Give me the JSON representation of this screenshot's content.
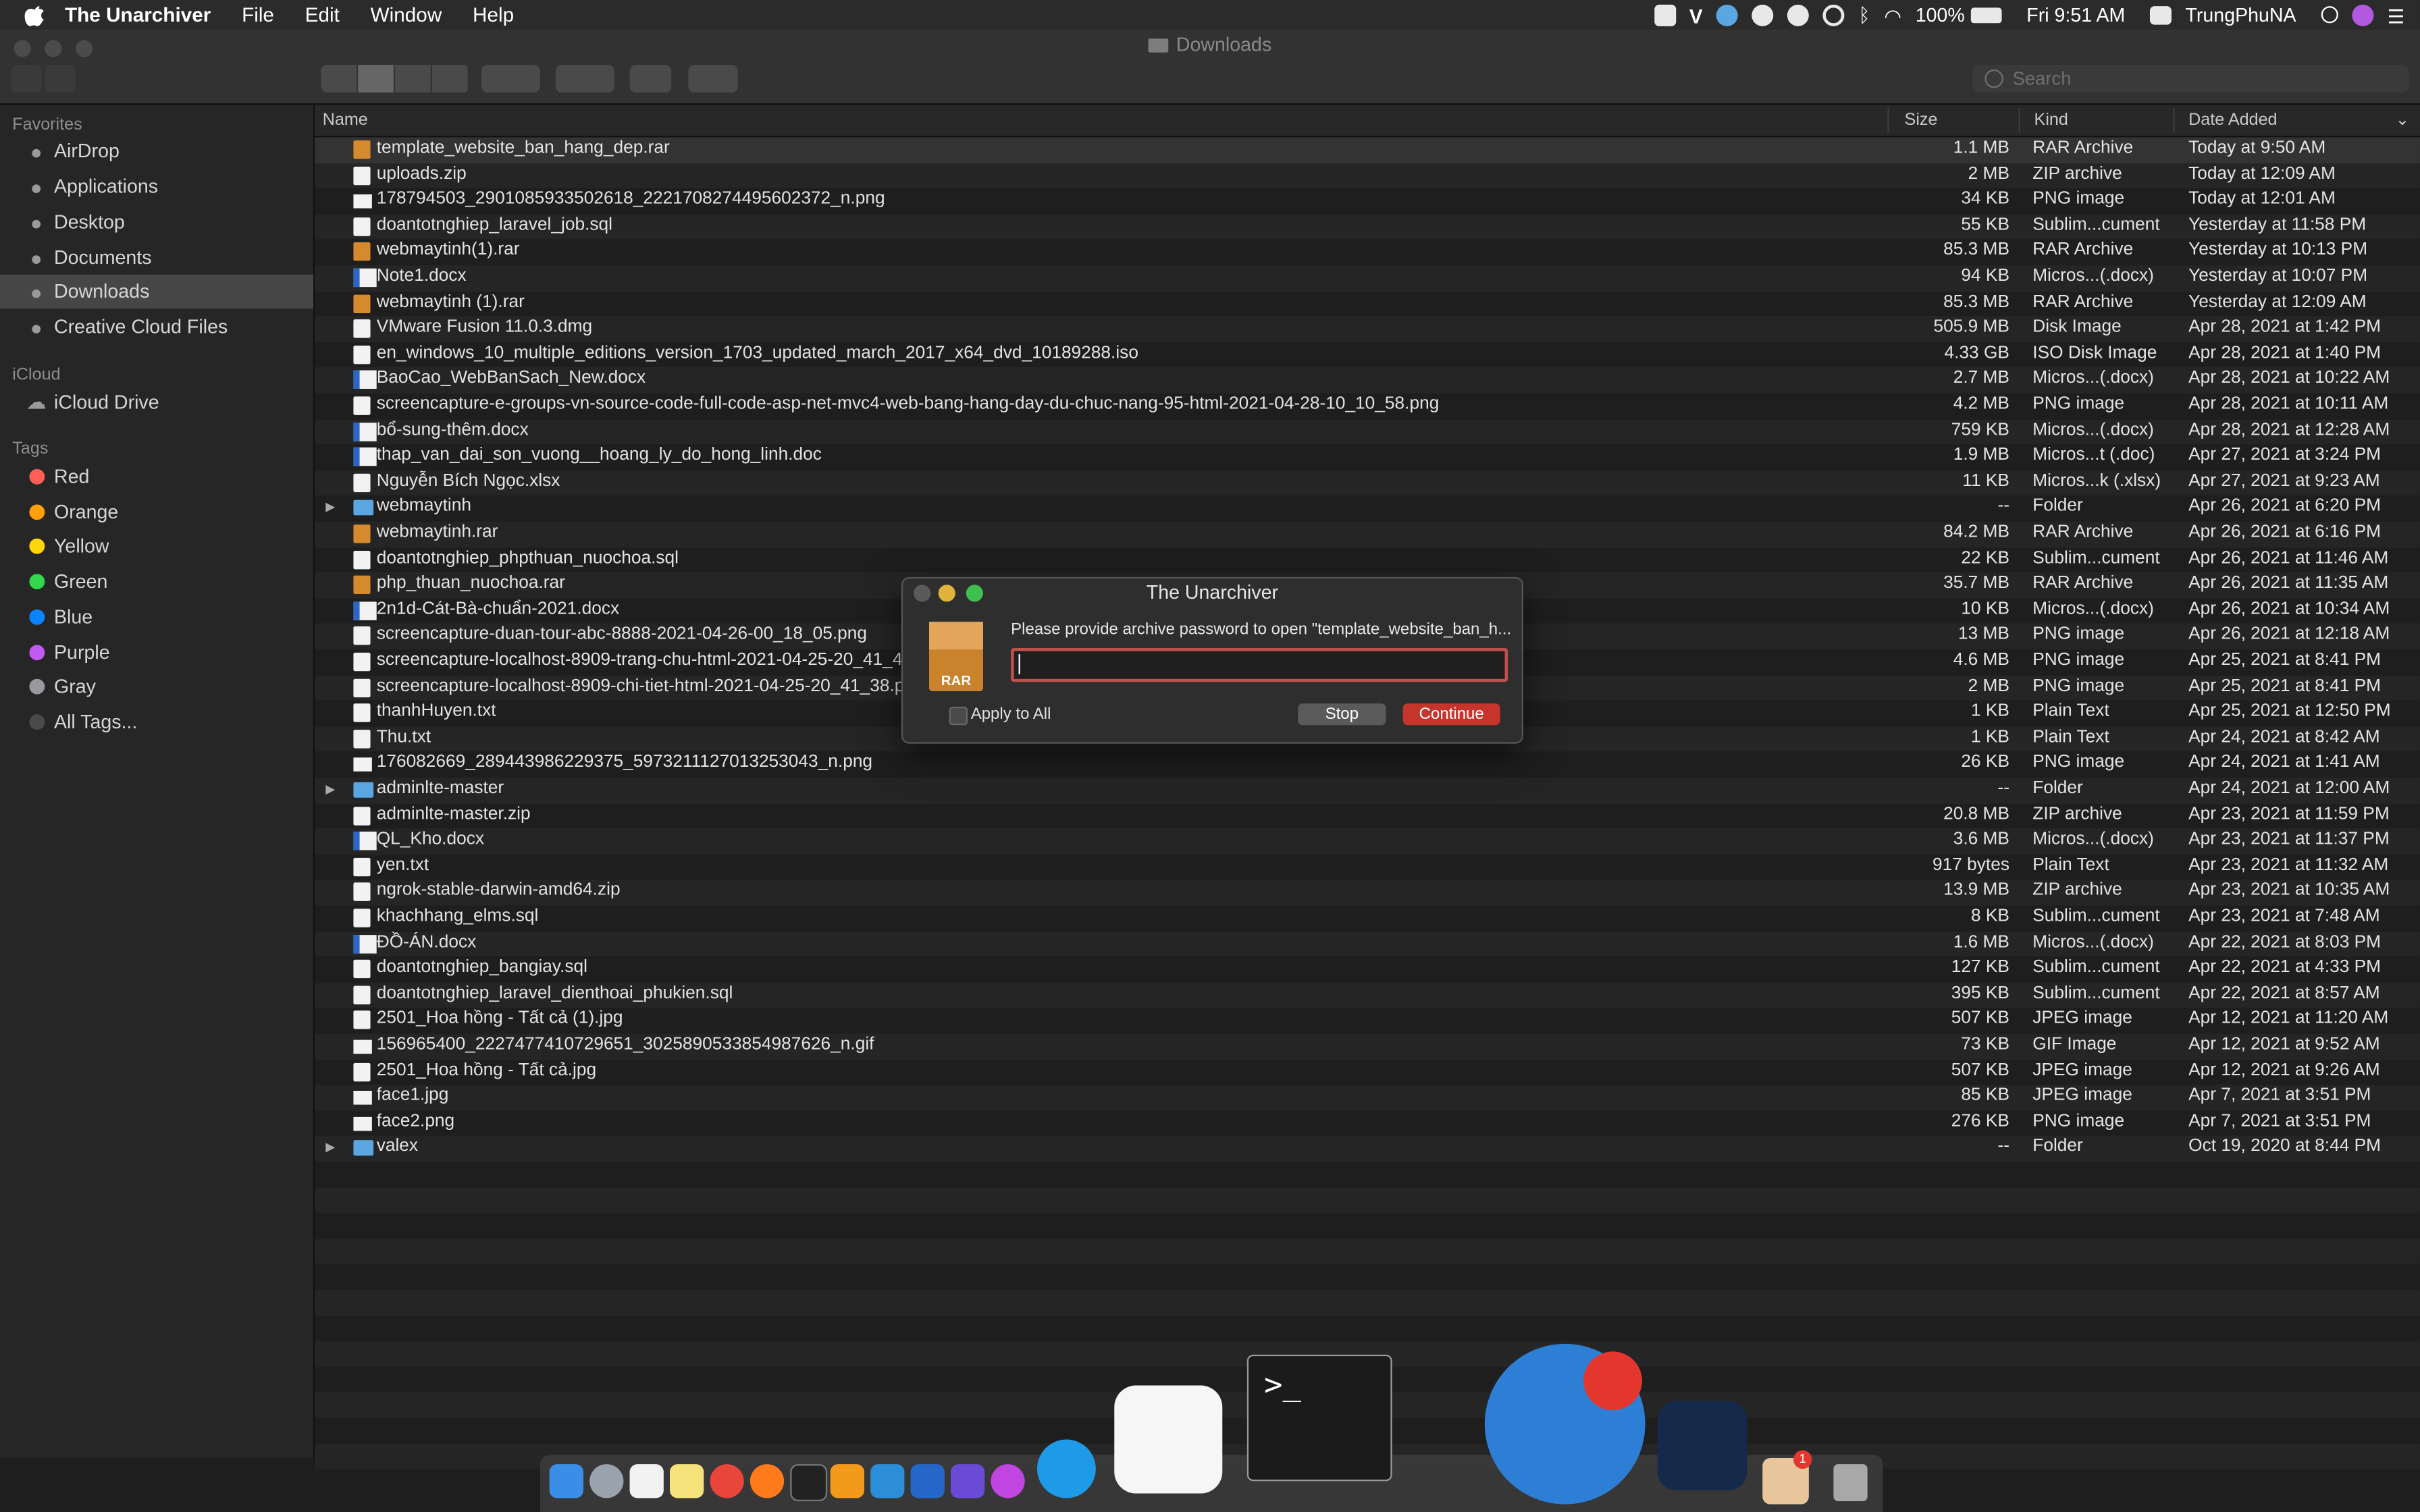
{
  "menubar": {
    "app_name": "The Unarchiver",
    "items": [
      "File",
      "Edit",
      "Window",
      "Help"
    ],
    "battery": "100%",
    "clock": "Fri 9:51 AM",
    "user": "TrungPhuNA"
  },
  "window": {
    "title": "Downloads",
    "search_placeholder": "Search"
  },
  "sidebar": {
    "favorites_header": "Favorites",
    "favorites": [
      {
        "label": "AirDrop",
        "icon": "airdrop-icon"
      },
      {
        "label": "Applications",
        "icon": "applications-icon"
      },
      {
        "label": "Desktop",
        "icon": "desktop-icon"
      },
      {
        "label": "Documents",
        "icon": "documents-icon"
      },
      {
        "label": "Downloads",
        "icon": "downloads-icon"
      },
      {
        "label": "Creative Cloud Files",
        "icon": "folder-icon"
      }
    ],
    "icloud_header": "iCloud",
    "icloud": [
      {
        "label": "iCloud Drive",
        "icon": "cloud-icon"
      }
    ],
    "tags_header": "Tags",
    "tags": [
      {
        "label": "Red",
        "color": "#ff5f57"
      },
      {
        "label": "Orange",
        "color": "#ff9f0a"
      },
      {
        "label": "Yellow",
        "color": "#ffd60a"
      },
      {
        "label": "Green",
        "color": "#32d74b"
      },
      {
        "label": "Blue",
        "color": "#0a84ff"
      },
      {
        "label": "Purple",
        "color": "#bf5af2"
      },
      {
        "label": "Gray",
        "color": "#98989d"
      },
      {
        "label": "All Tags...",
        "color": "#4a4a4a"
      }
    ]
  },
  "columns": {
    "name": "Name",
    "size": "Size",
    "kind": "Kind",
    "date": "Date Added"
  },
  "files": [
    {
      "name": "template_website_ban_hang_dep.rar",
      "size": "1.1 MB",
      "kind": "RAR Archive",
      "date": "Today at 9:50 AM",
      "icon": "rar"
    },
    {
      "name": "uploads.zip",
      "size": "2 MB",
      "kind": "ZIP archive",
      "date": "Today at 12:09 AM",
      "icon": "doc"
    },
    {
      "name": "178794503_2901085933502618_2221708274495602372_n.png",
      "size": "34 KB",
      "kind": "PNG image",
      "date": "Today at 12:01 AM",
      "icon": "img"
    },
    {
      "name": "doantotnghiep_laravel_job.sql",
      "size": "55 KB",
      "kind": "Sublim...cument",
      "date": "Yesterday at 11:58 PM",
      "icon": "doc"
    },
    {
      "name": "webmaytinh(1).rar",
      "size": "85.3 MB",
      "kind": "RAR Archive",
      "date": "Yesterday at 10:13 PM",
      "icon": "rar"
    },
    {
      "name": "Note1.docx",
      "size": "94 KB",
      "kind": "Micros...(.docx)",
      "date": "Yesterday at 10:07 PM",
      "icon": "word"
    },
    {
      "name": "webmaytinh (1).rar",
      "size": "85.3 MB",
      "kind": "RAR Archive",
      "date": "Yesterday at 12:09 AM",
      "icon": "rar"
    },
    {
      "name": "VMware Fusion 11.0.3.dmg",
      "size": "505.9 MB",
      "kind": "Disk Image",
      "date": "Apr 28, 2021 at 1:42 PM",
      "icon": "doc"
    },
    {
      "name": "en_windows_10_multiple_editions_version_1703_updated_march_2017_x64_dvd_10189288.iso",
      "size": "4.33 GB",
      "kind": "ISO Disk Image",
      "date": "Apr 28, 2021 at 1:40 PM",
      "icon": "doc"
    },
    {
      "name": "BaoCao_WebBanSach_New.docx",
      "size": "2.7 MB",
      "kind": "Micros...(.docx)",
      "date": "Apr 28, 2021 at 10:22 AM",
      "icon": "word"
    },
    {
      "name": "screencapture-e-groups-vn-source-code-full-code-asp-net-mvc4-web-bang-hang-day-du-chuc-nang-95-html-2021-04-28-10_10_58.png",
      "size": "4.2 MB",
      "kind": "PNG image",
      "date": "Apr 28, 2021 at 10:11 AM",
      "icon": "doc"
    },
    {
      "name": "bổ-sung-thêm.docx",
      "size": "759 KB",
      "kind": "Micros...(.docx)",
      "date": "Apr 28, 2021 at 12:28 AM",
      "icon": "word"
    },
    {
      "name": "thap_van_dai_son_vuong__hoang_ly_do_hong_linh.doc",
      "size": "1.9 MB",
      "kind": "Micros...t (.doc)",
      "date": "Apr 27, 2021 at 3:24 PM",
      "icon": "word"
    },
    {
      "name": "Nguyễn Bích Ngọc.xlsx",
      "size": "11 KB",
      "kind": "Micros...k (.xlsx)",
      "date": "Apr 27, 2021 at 9:23 AM",
      "icon": "doc"
    },
    {
      "name": "webmaytinh",
      "size": "--",
      "kind": "Folder",
      "date": "Apr 26, 2021 at 6:20 PM",
      "icon": "folder"
    },
    {
      "name": "webmaytinh.rar",
      "size": "84.2 MB",
      "kind": "RAR Archive",
      "date": "Apr 26, 2021 at 6:16 PM",
      "icon": "rar"
    },
    {
      "name": "doantotnghiep_phpthuan_nuochoa.sql",
      "size": "22 KB",
      "kind": "Sublim...cument",
      "date": "Apr 26, 2021 at 11:46 AM",
      "icon": "doc"
    },
    {
      "name": "php_thuan_nuochoa.rar",
      "size": "35.7 MB",
      "kind": "RAR Archive",
      "date": "Apr 26, 2021 at 11:35 AM",
      "icon": "rar"
    },
    {
      "name": "2n1d-Cát-Bà-chuẩn-2021.docx",
      "size": "10 KB",
      "kind": "Micros...(.docx)",
      "date": "Apr 26, 2021 at 10:34 AM",
      "icon": "word"
    },
    {
      "name": "screencapture-duan-tour-abc-8888-2021-04-26-00_18_05.png",
      "size": "13 MB",
      "kind": "PNG image",
      "date": "Apr 26, 2021 at 12:18 AM",
      "icon": "doc"
    },
    {
      "name": "screencapture-localhost-8909-trang-chu-html-2021-04-25-20_41_43.png",
      "size": "4.6 MB",
      "kind": "PNG image",
      "date": "Apr 25, 2021 at 8:41 PM",
      "icon": "doc"
    },
    {
      "name": "screencapture-localhost-8909-chi-tiet-html-2021-04-25-20_41_38.png",
      "size": "2 MB",
      "kind": "PNG image",
      "date": "Apr 25, 2021 at 8:41 PM",
      "icon": "doc"
    },
    {
      "name": "thanhHuyen.txt",
      "size": "1 KB",
      "kind": "Plain Text",
      "date": "Apr 25, 2021 at 12:50 PM",
      "icon": "doc"
    },
    {
      "name": "Thu.txt",
      "size": "1 KB",
      "kind": "Plain Text",
      "date": "Apr 24, 2021 at 8:42 AM",
      "icon": "doc"
    },
    {
      "name": "176082669_289443986229375_5973211127013253043_n.png",
      "size": "26 KB",
      "kind": "PNG image",
      "date": "Apr 24, 2021 at 1:41 AM",
      "icon": "img"
    },
    {
      "name": "adminlte-master",
      "size": "--",
      "kind": "Folder",
      "date": "Apr 24, 2021 at 12:00 AM",
      "icon": "folder"
    },
    {
      "name": "adminlte-master.zip",
      "size": "20.8 MB",
      "kind": "ZIP archive",
      "date": "Apr 23, 2021 at 11:59 PM",
      "icon": "doc"
    },
    {
      "name": "QL_Kho.docx",
      "size": "3.6 MB",
      "kind": "Micros...(.docx)",
      "date": "Apr 23, 2021 at 11:37 PM",
      "icon": "word"
    },
    {
      "name": "yen.txt",
      "size": "917 bytes",
      "kind": "Plain Text",
      "date": "Apr 23, 2021 at 11:32 AM",
      "icon": "doc"
    },
    {
      "name": "ngrok-stable-darwin-amd64.zip",
      "size": "13.9 MB",
      "kind": "ZIP archive",
      "date": "Apr 23, 2021 at 10:35 AM",
      "icon": "doc"
    },
    {
      "name": "khachhang_elms.sql",
      "size": "8 KB",
      "kind": "Sublim...cument",
      "date": "Apr 23, 2021 at 7:48 AM",
      "icon": "doc"
    },
    {
      "name": "ĐỒ-ÁN.docx",
      "size": "1.6 MB",
      "kind": "Micros...(.docx)",
      "date": "Apr 22, 2021 at 8:03 PM",
      "icon": "word"
    },
    {
      "name": "doantotnghiep_bangiay.sql",
      "size": "127 KB",
      "kind": "Sublim...cument",
      "date": "Apr 22, 2021 at 4:33 PM",
      "icon": "doc"
    },
    {
      "name": "doantotnghiep_laravel_dienthoai_phukien.sql",
      "size": "395 KB",
      "kind": "Sublim...cument",
      "date": "Apr 22, 2021 at 8:57 AM",
      "icon": "doc"
    },
    {
      "name": "2501_Hoa hồng -  Tất cả (1).jpg",
      "size": "507 KB",
      "kind": "JPEG image",
      "date": "Apr 12, 2021 at 11:20 AM",
      "icon": "doc"
    },
    {
      "name": "156965400_2227477410729651_3025890533854987626_n.gif",
      "size": "73 KB",
      "kind": "GIF Image",
      "date": "Apr 12, 2021 at 9:52 AM",
      "icon": "img"
    },
    {
      "name": "2501_Hoa hồng -  Tất cả.jpg",
      "size": "507 KB",
      "kind": "JPEG image",
      "date": "Apr 12, 2021 at 9:26 AM",
      "icon": "doc"
    },
    {
      "name": "face1.jpg",
      "size": "85 KB",
      "kind": "JPEG image",
      "date": "Apr 7, 2021 at 3:51 PM",
      "icon": "img"
    },
    {
      "name": "face2.png",
      "size": "276 KB",
      "kind": "PNG image",
      "date": "Apr 7, 2021 at 3:51 PM",
      "icon": "img"
    },
    {
      "name": "valex",
      "size": "--",
      "kind": "Folder",
      "date": "Oct 19, 2020 at 8:44 PM",
      "icon": "folder"
    }
  ],
  "dialog": {
    "title": "The Unarchiver",
    "message": "Please provide archive password to open \"template_website_ban_h...",
    "archive_label": "RAR",
    "password_value": "",
    "apply_all_label": "Apply to All",
    "stop_label": "Stop",
    "continue_label": "Continue"
  },
  "dock": {
    "terminal_prompt": ">_",
    "badge_count": "1"
  }
}
